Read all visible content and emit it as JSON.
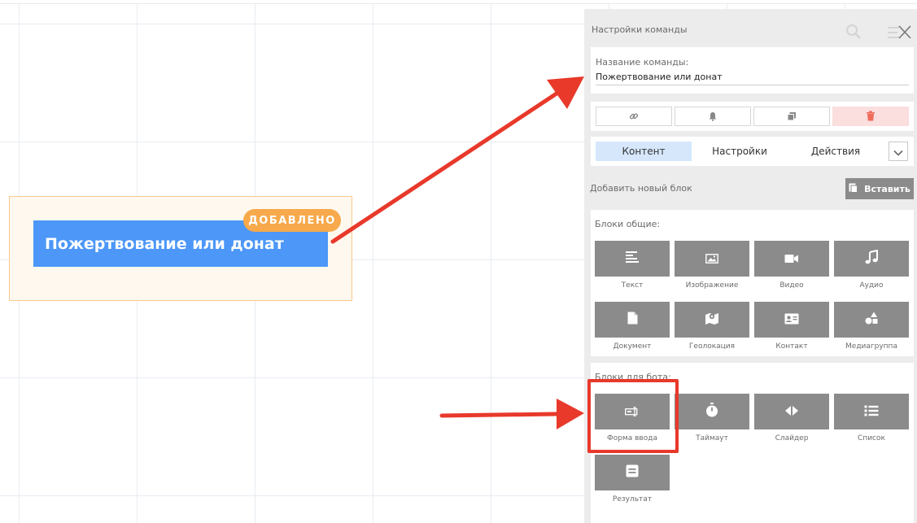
{
  "canvas": {
    "node_title": "Пожертвование или донат",
    "node_badge": "ДОБАВЛЕНО"
  },
  "panel": {
    "title": "Настройки команды",
    "search_icon": "search-icon",
    "close_icon": "close-icon",
    "command_name": {
      "label": "Название команды:",
      "value": "Пожертвование или донат"
    },
    "tools": [
      {
        "icon": "link-icon"
      },
      {
        "icon": "bell-icon"
      },
      {
        "icon": "copy-icon"
      },
      {
        "icon": "trash-icon"
      }
    ],
    "tabs": [
      {
        "label": "Контент",
        "active": true
      },
      {
        "label": "Настройки",
        "active": false
      },
      {
        "label": "Действия",
        "active": false
      }
    ],
    "add_block_label": "Добавить новый блок",
    "paste_label": "Вставить",
    "common_blocks": {
      "title": "Блоки общие:",
      "items": [
        {
          "label": "Текст",
          "icon": "text-icon"
        },
        {
          "label": "Изображение",
          "icon": "image-icon"
        },
        {
          "label": "Видео",
          "icon": "video-icon"
        },
        {
          "label": "Аудио",
          "icon": "audio-icon"
        },
        {
          "label": "Документ",
          "icon": "document-icon"
        },
        {
          "label": "Геолокация",
          "icon": "map-icon"
        },
        {
          "label": "Контакт",
          "icon": "contact-icon"
        },
        {
          "label": "Медиагруппа",
          "icon": "media-group-icon"
        }
      ]
    },
    "bot_blocks": {
      "title": "Блоки для бота:",
      "items": [
        {
          "label": "Форма ввода",
          "icon": "input-form-icon"
        },
        {
          "label": "Таймаут",
          "icon": "timer-icon"
        },
        {
          "label": "Слайдер",
          "icon": "slider-icon"
        },
        {
          "label": "Список",
          "icon": "list-icon"
        },
        {
          "label": "Результат",
          "icon": "result-icon"
        }
      ]
    }
  },
  "colors": {
    "node_blue": "#4c97f8",
    "badge_orange": "#f7a94b",
    "tile_gray": "#8b8b8b",
    "annotation_red": "#e8392b",
    "delete_pink": "#fbdede"
  }
}
